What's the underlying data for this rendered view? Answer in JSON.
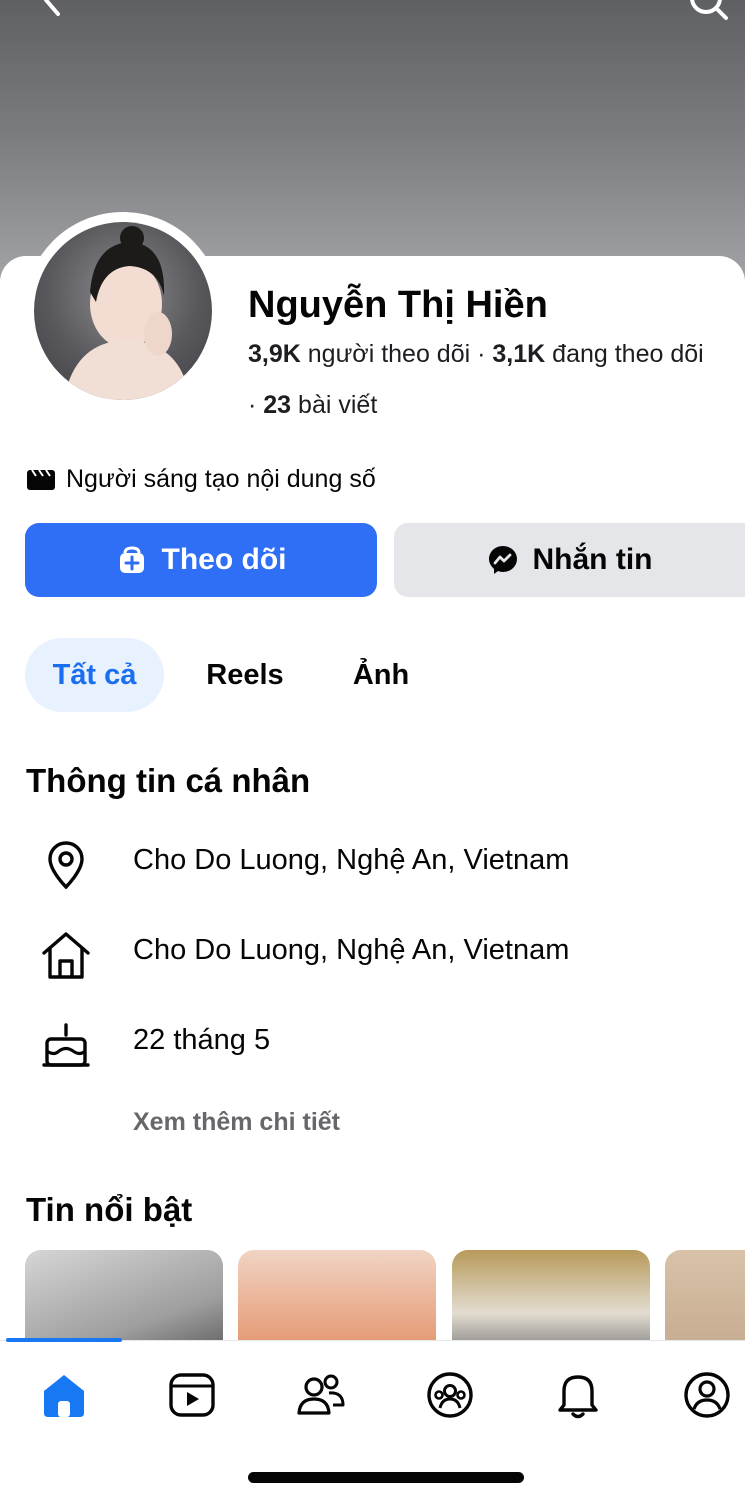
{
  "profile": {
    "name": "Nguyễn Thị Hiền",
    "followers_count": "3,9K",
    "followers_label": "người theo dõi",
    "following_count": "3,1K",
    "following_label": "đang theo dõi",
    "posts_count": "23",
    "posts_label": "bài viết",
    "category_icon": "clapperboard-icon",
    "category": "Người sáng tạo nội dung số"
  },
  "actions": {
    "follow_label": "Theo dõi",
    "follow_icon": "follow-icon",
    "message_label": "Nhắn tin",
    "message_icon": "messenger-icon",
    "accent_color": "#2f6ff5"
  },
  "tabs": [
    {
      "label": "Tất cả",
      "active": true
    },
    {
      "label": "Reels",
      "active": false
    },
    {
      "label": "Ảnh",
      "active": false
    }
  ],
  "about": {
    "title": "Thông tin cá nhân",
    "items": [
      {
        "icon": "location-pin-icon",
        "text": "Cho Do Luong, Nghệ An, Vietnam"
      },
      {
        "icon": "home-icon",
        "text": "Cho Do Luong, Nghệ An, Vietnam"
      },
      {
        "icon": "birthday-cake-icon",
        "text": "22 tháng 5"
      }
    ],
    "see_more": "Xem thêm chi tiết"
  },
  "highlights": {
    "title": "Tin nổi bật"
  },
  "bottom_nav": [
    {
      "icon": "home-icon",
      "active": true
    },
    {
      "icon": "video-icon",
      "active": false
    },
    {
      "icon": "friends-icon",
      "active": false
    },
    {
      "icon": "groups-icon",
      "active": false
    },
    {
      "icon": "notifications-icon",
      "active": false
    },
    {
      "icon": "profile-icon",
      "active": false
    }
  ]
}
